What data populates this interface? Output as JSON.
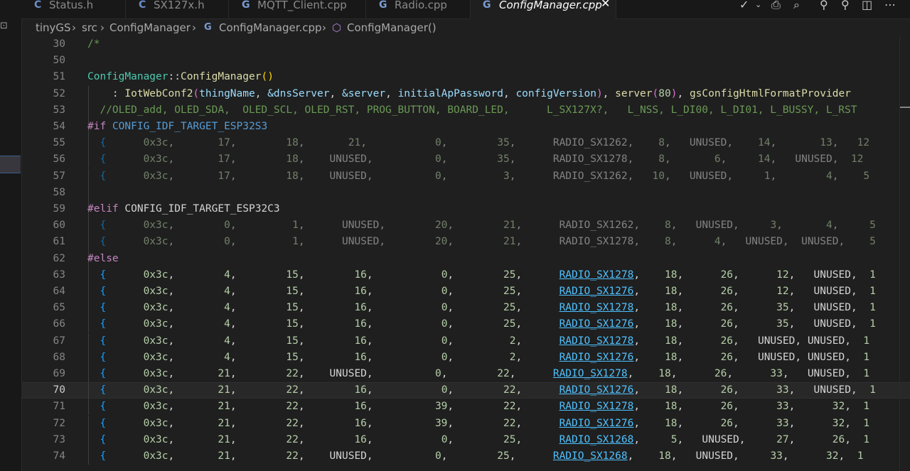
{
  "tabs": [
    {
      "label": "Status.h",
      "icon": "C",
      "kind": "c-header"
    },
    {
      "label": "SX127x.h",
      "icon": "C",
      "kind": "c-header"
    },
    {
      "label": "MQTT_Client.cpp",
      "icon": "G",
      "kind": "cpp"
    },
    {
      "label": "Radio.cpp",
      "icon": "G",
      "kind": "cpp"
    },
    {
      "label": "ConfigManager.cpp",
      "icon": "G",
      "kind": "cpp",
      "active": true
    }
  ],
  "breadcrumb": {
    "project": "tinyGS",
    "folder": "src",
    "subfolder": "ConfigManager",
    "file": "ConfigManager.cpp",
    "symbol": "ConfigManager()"
  },
  "icons": {
    "close": "close-icon",
    "check": "check-icon",
    "dropdown": "chevron-down-icon",
    "print": "print-icon",
    "inspect": "inspect-icon",
    "pin1": "pin-icon",
    "pin2": "pin-icon",
    "split": "split-editor-icon",
    "more": "more-icon"
  },
  "colors": {
    "background": "#1f1f1f",
    "keyword": "#c586c0",
    "macro": "#569cd6",
    "function": "#dcdcaa",
    "number": "#b5cea8",
    "comment": "#6a9955",
    "link": "#4fc1ff"
  },
  "editor": {
    "current_line": "70",
    "lines": [
      {
        "n": "30",
        "code": "/*"
      },
      {
        "n": "50",
        "code": ""
      },
      {
        "n": "51",
        "code": "ConfigManager::ConfigManager()"
      },
      {
        "n": "52",
        "code": "    : IotWebConf2(thingName, &dnsServer, &server, initialApPassword, configVersion), server(80), gsConfigHtmlFormatProvider"
      },
      {
        "n": "53",
        "code": "  //OLED_add, OLED_SDA,  OLED_SCL, OLED_RST, PROG_BUTTON, BOARD_LED,      L_SX127X?,   L_NSS, L_DI00, L_DI01, L_BUSSY, L_RST"
      },
      {
        "n": "54",
        "code": "#if CONFIG_IDF_TARGET_ESP32S3"
      },
      {
        "n": "55",
        "code": "  {      0x3c,       17,        18,       21,           0,        35,      RADIO_SX1262,    8,   UNUSED,    14,       13,   12"
      },
      {
        "n": "56",
        "code": "  {      0x3c,       17,        18,    UNUSED,          0,        35,      RADIO_SX1278,    8,       6,     14,   UNUSED,  12"
      },
      {
        "n": "57",
        "code": "  {      0x3c,       17,        18,    UNUSED,          0,         3,      RADIO_SX1262,   10,   UNUSED,     1,        4,    5"
      },
      {
        "n": "58",
        "code": ""
      },
      {
        "n": "59",
        "code": "#elif CONFIG_IDF_TARGET_ESP32C3"
      },
      {
        "n": "60",
        "code": "  {      0x3c,        0,         1,      UNUSED,        20,        21,      RADIO_SX1262,    8,   UNUSED,     3,       4,     5"
      },
      {
        "n": "61",
        "code": "  {      0x3c,        0,         1,      UNUSED,        20,        21,      RADIO_SX1278,    8,      4,   UNUSED,  UNUSED,    5"
      },
      {
        "n": "62",
        "code": "#else"
      },
      {
        "n": "63",
        "code": "  {      0x3c,        4,        15,        16,           0,        25,      RADIO_SX1278,    18,      26,      12,   UNUSED,  1"
      },
      {
        "n": "64",
        "code": "  {      0x3c,        4,        15,        16,           0,        25,      RADIO_SX1276,    18,      26,      12,   UNUSED,  1"
      },
      {
        "n": "65",
        "code": "  {      0x3c,        4,        15,        16,           0,        25,      RADIO_SX1278,    18,      26,      35,   UNUSED,  1"
      },
      {
        "n": "66",
        "code": "  {      0x3c,        4,        15,        16,           0,        25,      RADIO_SX1276,    18,      26,      35,   UNUSED,  1"
      },
      {
        "n": "67",
        "code": "  {      0x3c,        4,        15,        16,           0,         2,      RADIO_SX1278,    18,      26,   UNUSED, UNUSED,  1"
      },
      {
        "n": "68",
        "code": "  {      0x3c,        4,        15,        16,           0,         2,      RADIO_SX1276,    18,      26,   UNUSED, UNUSED,  1"
      },
      {
        "n": "69",
        "code": "  {      0x3c,       21,        22,    UNUSED,          0,        22,      RADIO_SX1278,    18,      26,      33,   UNUSED,  1"
      },
      {
        "n": "70",
        "code": "  {      0x3c,       21,        22,        16,           0,        22,      RADIO_SX1276,    18,      26,      33,   UNUSED,  1"
      },
      {
        "n": "71",
        "code": "  {      0x3c,       21,        22,        16,          39,        22,      RADIO_SX1278,    18,      26,      33,      32,  1"
      },
      {
        "n": "72",
        "code": "  {      0x3c,       21,        22,        16,          39,        22,      RADIO_SX1276,    18,      26,      33,      32,  1"
      },
      {
        "n": "73",
        "code": "  {      0x3c,       21,        22,        16,           0,        25,      RADIO_SX1268,     5,   UNUSED,     27,      26,  1"
      },
      {
        "n": "74",
        "code": "  {      0x3c,       21,        22,    UNUSED,          0,        25,      RADIO_SX1268,    18,   UNUSED,     33,      32,  1"
      }
    ]
  }
}
